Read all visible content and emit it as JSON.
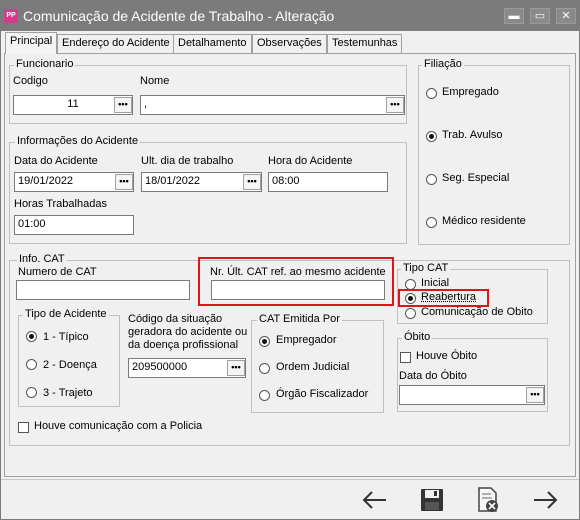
{
  "window": {
    "icon_text": "PP",
    "title": "Comunicação de Acidente de Trabalho - Alteração",
    "buttons": {
      "minimize": "▬",
      "maximize": "▭",
      "close": "✕"
    }
  },
  "tabs": [
    {
      "label": "Principal",
      "active": true
    },
    {
      "label": "Endereço do Acidente"
    },
    {
      "label": "Detalhamento"
    },
    {
      "label": "Observações"
    },
    {
      "label": "Testemunhas"
    }
  ],
  "funcionario": {
    "group_label": "Funcionario",
    "codigo_label": "Codigo",
    "codigo_value": "11",
    "nome_label": "Nome",
    "nome_value": ","
  },
  "filiacao": {
    "group_label": "Filiação",
    "options": [
      {
        "label": "Empregado",
        "selected": false
      },
      {
        "label": "Trab. Avulso",
        "selected": true
      },
      {
        "label": "Seg. Especial",
        "selected": false
      },
      {
        "label": "Médico residente",
        "selected": false
      }
    ]
  },
  "acidente": {
    "group_label": "Informações do Acidente",
    "data_label": "Data do Acidente",
    "data_value": "19/01/2022",
    "ult_dia_label": "Ult. dia de trabalho",
    "ult_dia_value": "18/01/2022",
    "hora_label": "Hora do Acidente",
    "hora_value": "08:00",
    "horas_trab_label": "Horas Trabalhadas",
    "horas_trab_value": "01:00"
  },
  "info_cat": {
    "group_label": "Info. CAT",
    "numero_label": "Numero de CAT",
    "numero_value": "",
    "nr_ult_label": "Nr. Últ. CAT ref. ao mesmo acidente",
    "nr_ult_value": "",
    "tipo_cat": {
      "group_label": "Tipo CAT",
      "options": [
        {
          "label": "Inicial",
          "selected": false
        },
        {
          "label": "Reabertura",
          "selected": true
        },
        {
          "label": "Comunicação de Obito",
          "selected": false
        }
      ]
    },
    "tipo_acidente": {
      "group_label": "Tipo de Acidente",
      "options": [
        {
          "label": "1 - Típico",
          "selected": true
        },
        {
          "label": "2 - Doença",
          "selected": false
        },
        {
          "label": "3 - Trajeto",
          "selected": false
        }
      ]
    },
    "codigo_situacao": {
      "label_lines": [
        "Código da situação",
        "geradora do acidente ou",
        "da doença profissional"
      ],
      "value": "209500000"
    },
    "emitida_por": {
      "group_label": "CAT Emitida Por",
      "options": [
        {
          "label": "Empregador",
          "selected": true
        },
        {
          "label": "Ordem Judicial",
          "selected": false
        },
        {
          "label": "Órgão Fiscalizador",
          "selected": false
        }
      ]
    },
    "obito": {
      "group_label": "Óbito",
      "houve_label": "Houve Óbito",
      "houve_checked": false,
      "data_label": "Data do Óbito",
      "data_value": ""
    },
    "policia_label": "Houve comunicação com a Policia",
    "policia_checked": false
  },
  "ellipsis": "•••",
  "toolbar": {
    "icons": [
      "arrow-left-icon",
      "save-icon",
      "cancel-document-icon",
      "arrow-right-icon"
    ]
  },
  "colors": {
    "titlebar": "#7b7b7b",
    "highlight": "#e0141e",
    "window_bg": "#f0f0f0"
  }
}
